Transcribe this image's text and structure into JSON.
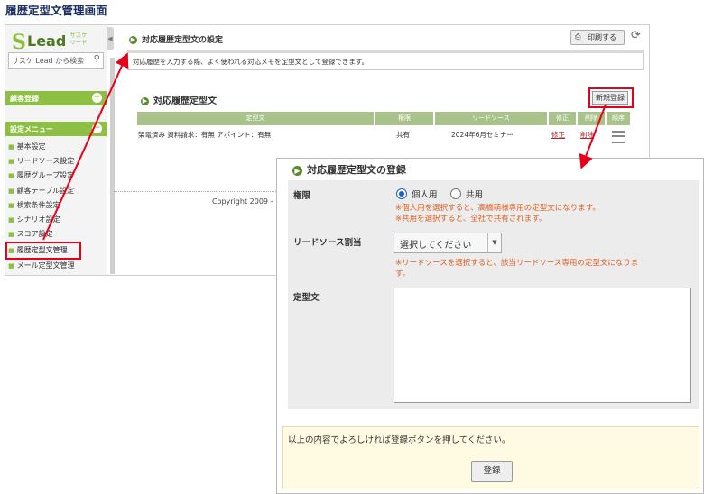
{
  "page_title": "履歴定型文管理画面",
  "logo": {
    "text": "Lead",
    "sub": "サスケ\nリード"
  },
  "search": {
    "placeholder": "サスケ Lead から検索"
  },
  "sidebar": {
    "customer_section": "顧客登録",
    "settings_section": "設定メニュー",
    "items": [
      {
        "label": "基本設定"
      },
      {
        "label": "リードソース設定"
      },
      {
        "label": "履歴グループ設定"
      },
      {
        "label": "顧客テーブル設定"
      },
      {
        "label": "検索条件設定"
      },
      {
        "label": "シナリオ設定"
      },
      {
        "label": "スコア設定"
      },
      {
        "label": "履歴定型文管理"
      },
      {
        "label": "メール定型文管理"
      }
    ]
  },
  "main": {
    "section_title": "対応履歴定型文の設定",
    "print_label": "印刷する",
    "description": "対応履歴を入力する際、よく使われる対応メモを定型文として登録できます。",
    "list_title": "対応履歴定型文",
    "new_button": "新規登録",
    "columns": [
      "定型文",
      "権限",
      "リードソース",
      "修正",
      "削除",
      "順序"
    ],
    "rows": [
      {
        "text": "架電済み 資料請求：有無 アポイント：有無",
        "permission": "共有",
        "source": "2024年6月セミナー",
        "edit": "修正",
        "delete": "削除"
      }
    ],
    "copyright": "Copyright 2009 -"
  },
  "dialog": {
    "title": "対応履歴定型文の登録",
    "permission_label": "権限",
    "options": [
      "個人用",
      "共用"
    ],
    "selected_option": "個人用",
    "permission_notes": [
      "※個人用を選択すると、高橋萌様専用の定型文になります。",
      "※共用を選択すると、全社で共有されます。"
    ],
    "source_label": "リードソース割当",
    "source_select_value": "選択してください",
    "source_note_1": "※リードソースを選択すると、該当リードソース専用の定型文になりま",
    "source_note_2": "す。",
    "text_label": "定型文",
    "text_value": "",
    "confirm_message": "以上の内容でよろしければ登録ボタンを押してください。",
    "submit_label": "登録"
  },
  "colors": {
    "accent_green": "#8dbf42",
    "highlight_red": "#e8001a",
    "note_orange": "#e0601f"
  }
}
